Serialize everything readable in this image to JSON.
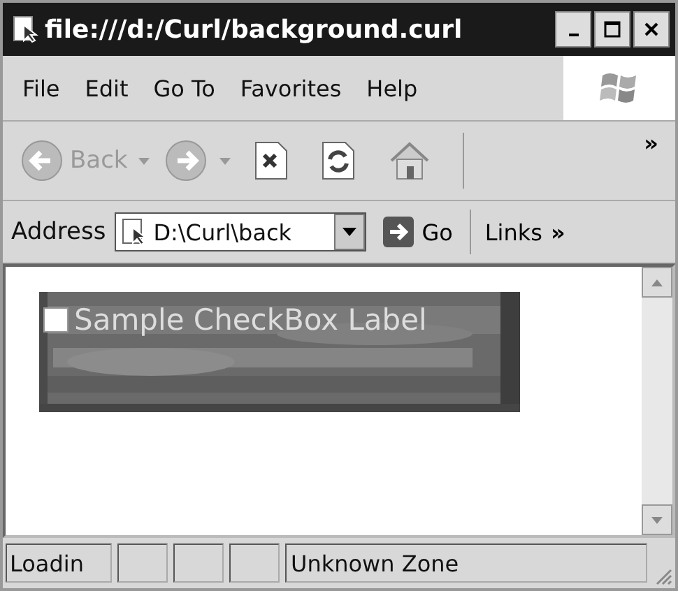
{
  "window": {
    "title": "file:///d:/Curl/background.curl"
  },
  "menu": [
    "File",
    "Edit",
    "Go To",
    "Favorites",
    "Help"
  ],
  "toolbar": {
    "buttons": [
      {
        "kind": "back",
        "label": "Back",
        "disabled": true
      },
      {
        "kind": "forward",
        "disabled": true
      },
      {
        "kind": "stop",
        "disabled": false
      },
      {
        "kind": "refresh",
        "disabled": false
      },
      {
        "kind": "home",
        "disabled": false
      }
    ],
    "more": "»"
  },
  "address_bar": {
    "label": "Address",
    "value": "D:\\Curl\\back",
    "go": "Go",
    "links": "Links",
    "more": "»"
  },
  "content": {
    "checkbox": {
      "label": "Sample CheckBox Label",
      "checked": false
    }
  },
  "status_bar": {
    "text": "Loadin",
    "zone": "Unknown Zone"
  }
}
